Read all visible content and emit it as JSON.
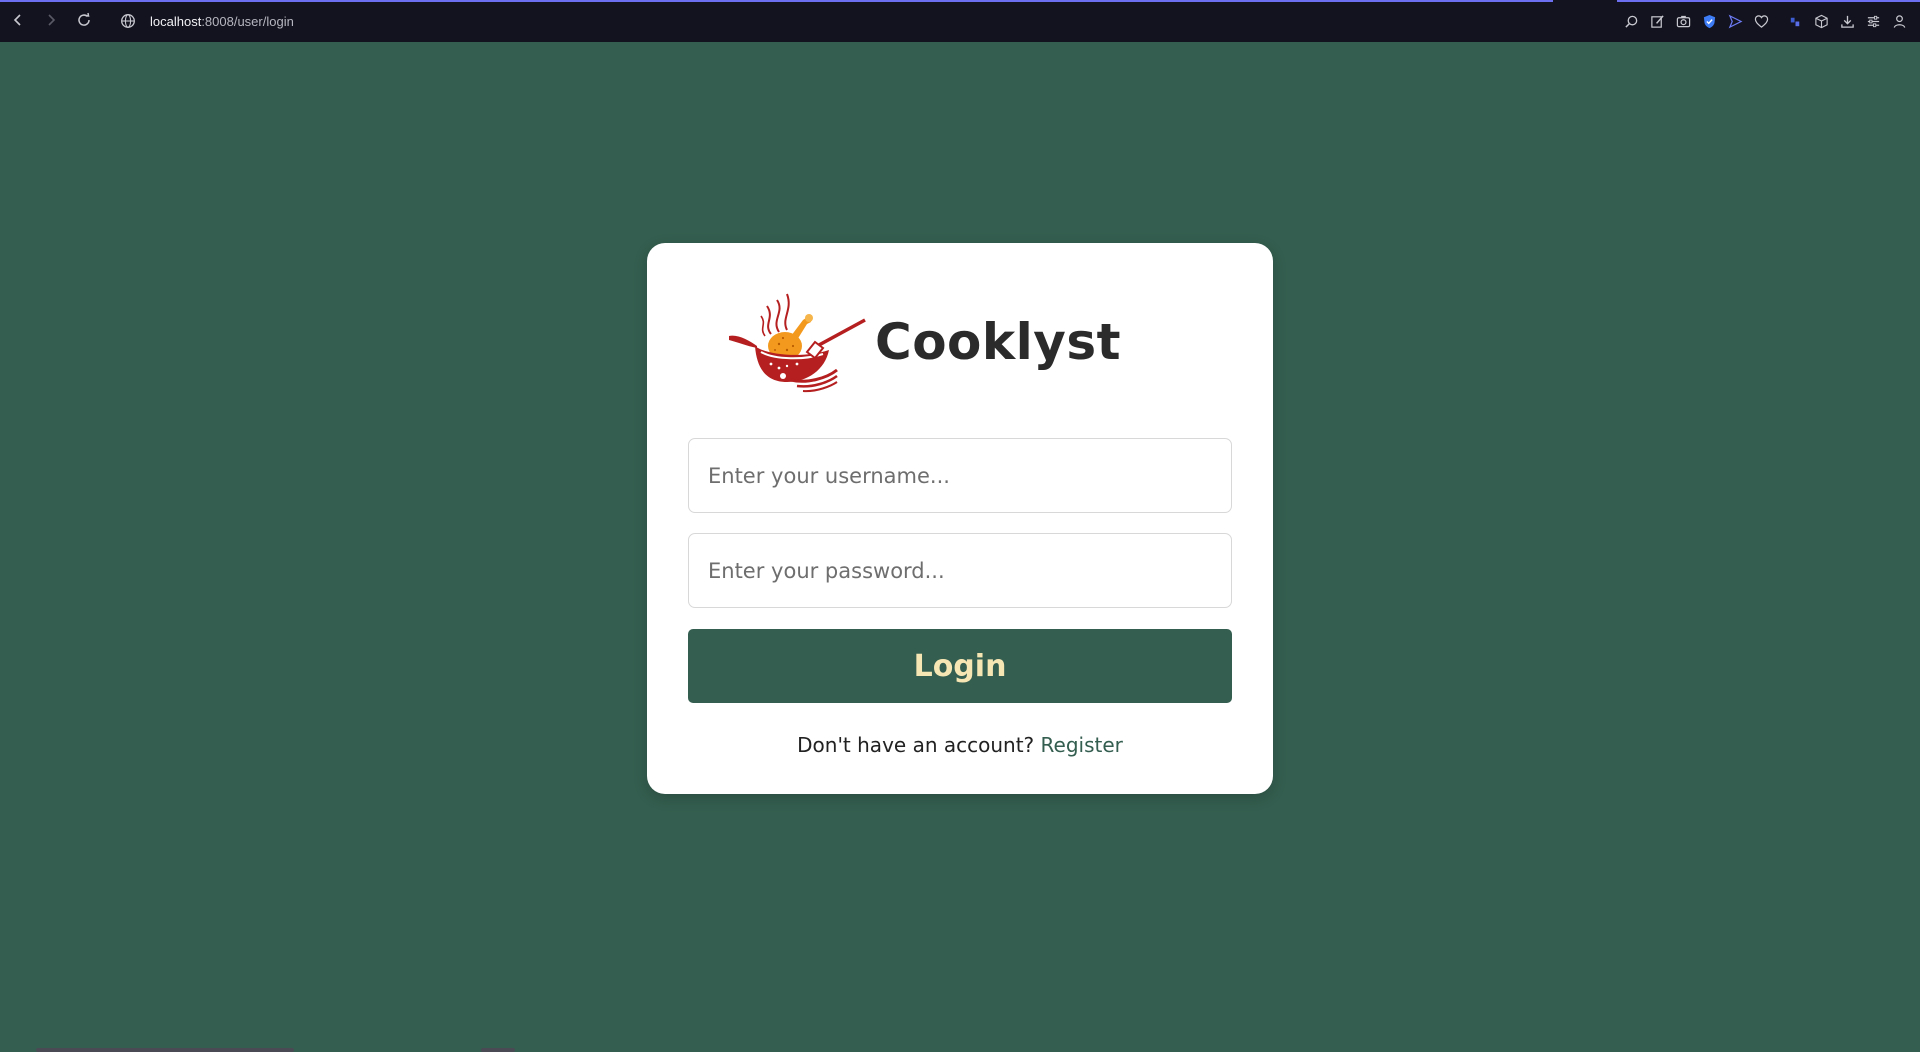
{
  "browser": {
    "url_host": "localhost",
    "url_rest": ":8008/user/login",
    "icons": {
      "back": "arrow-left-icon",
      "forward": "arrow-right-icon",
      "reload": "reload-icon",
      "site_info": "globe-icon",
      "toolbar": [
        "zoom-icon",
        "edit-icon",
        "camera-icon",
        "shield-icon",
        "send-icon",
        "heart-icon",
        "extension-icon",
        "cube-icon",
        "download-icon",
        "settings-icon",
        "profile-icon"
      ]
    }
  },
  "brand": {
    "name": "Cooklyst",
    "logo": "chicken-wok-logo"
  },
  "form": {
    "username_placeholder": "Enter your username...",
    "password_placeholder": "Enter your password...",
    "login_label": "Login",
    "register_prompt": "Don't have an account?",
    "register_label": "Register"
  },
  "colors": {
    "background": "#345e4f",
    "card": "#ffffff",
    "button": "#345e4f",
    "button_text": "#f6e6b4",
    "logo_red": "#b51f1f",
    "logo_orange": "#f39a1e"
  }
}
